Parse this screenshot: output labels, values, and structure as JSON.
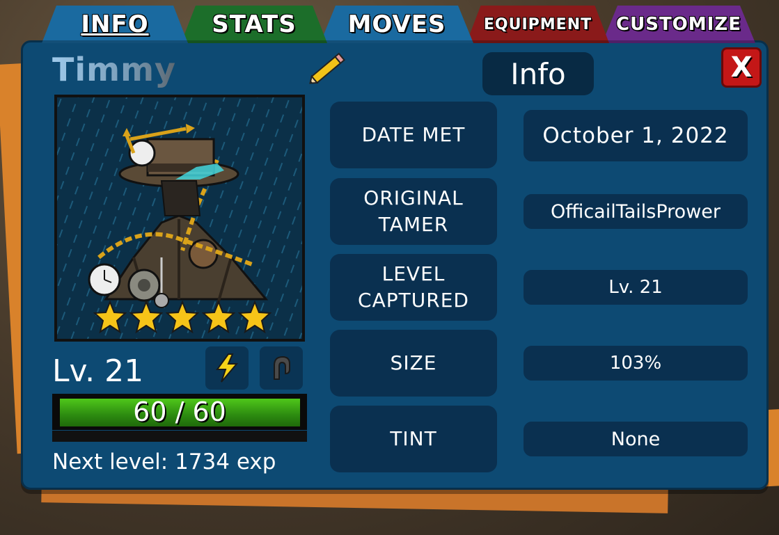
{
  "tabs": [
    {
      "label": "INFO",
      "color": "#1a6aa0",
      "active": true
    },
    {
      "label": "STATS",
      "color": "#1c6e2a"
    },
    {
      "label": "MOVES",
      "color": "#1a6aa0"
    },
    {
      "label": "EQUIPMENT",
      "color": "#8a1a1a"
    },
    {
      "label": "CUSTOMIZE",
      "color": "#6a2a8a"
    }
  ],
  "creature": {
    "name": "Timmy",
    "stars": 5,
    "level_label": "Lv. 21",
    "hp_text": "60 / 60",
    "hp_fraction": 1.0,
    "next_level_text": "Next level: 1734 exp"
  },
  "icons": {
    "edit": "pencil-icon",
    "close": "close-icon",
    "type1": "lightning-icon",
    "type2": "sound-icon"
  },
  "header": {
    "title": "Info",
    "close_label": "X"
  },
  "info_rows": [
    {
      "label": "DATE MET",
      "value": "October 1, 2022"
    },
    {
      "label": "ORIGINAL\nTAMER",
      "value": "OfficailTailsPrower"
    },
    {
      "label": "LEVEL\nCAPTURED",
      "value": "Lv. 21"
    },
    {
      "label": "SIZE",
      "value": "103%"
    },
    {
      "label": "TINT",
      "value": "None"
    }
  ],
  "colors": {
    "panel": "#0d4a73",
    "box": "#0a3050",
    "hp": "#3cae14",
    "close": "#c41717",
    "star": "#f6c418"
  }
}
